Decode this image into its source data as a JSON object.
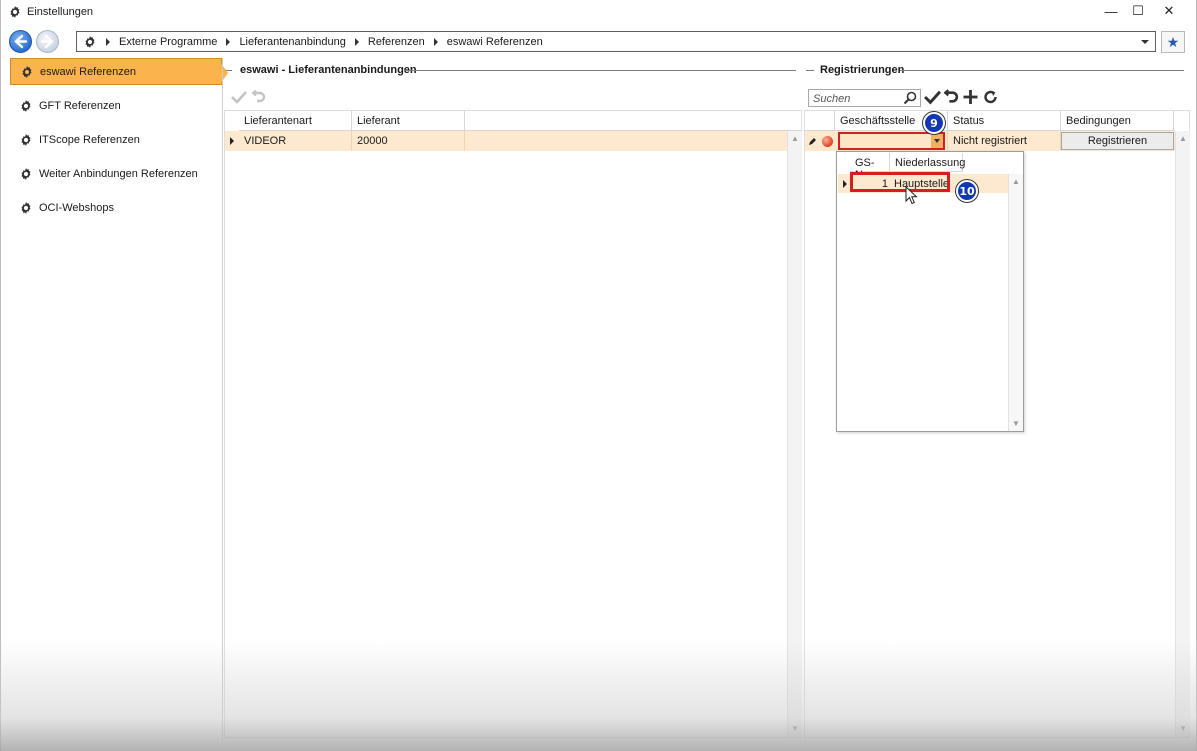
{
  "window": {
    "title": "Einstellungen",
    "controls": {
      "minimize": "—",
      "maximize": "☐",
      "close": "✕"
    }
  },
  "address": {
    "crumbs": [
      "Externe Programme",
      "Lieferantenanbindung",
      "Referenzen",
      "eswawi Referenzen"
    ],
    "favorite_icon": "star-icon"
  },
  "sidebar": {
    "items": [
      {
        "label": "eswawi Referenzen",
        "active": true
      },
      {
        "label": "GFT Referenzen",
        "active": false
      },
      {
        "label": "ITScope Referenzen",
        "active": false
      },
      {
        "label": "Weiter Anbindungen Referenzen",
        "active": false
      },
      {
        "label": "OCI-Webshops",
        "active": false
      }
    ]
  },
  "left_panel": {
    "title": "eswawi - Lieferantenanbindungen",
    "columns": [
      "Lieferantenart",
      "Lieferant"
    ],
    "rows": [
      {
        "lieferantenart": "VIDEOR",
        "lieferant": "20000"
      }
    ]
  },
  "right_panel": {
    "title": "Registrierungen",
    "search_placeholder": "Suchen",
    "columns": [
      "Geschäftsstelle",
      "Status",
      "Bedingungen"
    ],
    "row": {
      "status": "Nicht registriert",
      "action_label": "Registrieren"
    },
    "dropdown": {
      "columns": [
        "GS-Nr.",
        "Niederlassung"
      ],
      "rows": [
        {
          "gs_nr": "1",
          "niederlassung": "Hauptstelle"
        }
      ]
    }
  },
  "annotations": {
    "step_9": "9",
    "step_10": "10"
  },
  "colors": {
    "accent_orange": "#fbb34e",
    "row_highlight": "#fde9cf",
    "annotation_red": "#d31f1f",
    "badge_blue": "#1437b5"
  }
}
